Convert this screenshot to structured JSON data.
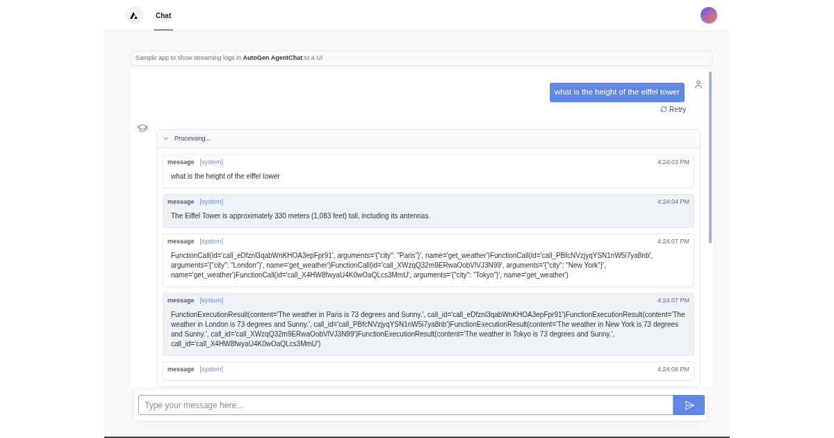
{
  "header": {
    "tabs": [
      {
        "label": "Chat",
        "selected": true
      }
    ]
  },
  "banner": {
    "text": "Sample app to show streaming logs in **AutoGen AgentChat** to a UI"
  },
  "chat": {
    "user_message": "what is the height of the eiffel tower",
    "retry_label": "Retry",
    "processing": {
      "title": "Processing...",
      "expanded": true,
      "messages": [
        {
          "label": "message",
          "source": "[system]",
          "time": "4:24:03 PM",
          "text": "what is the height of the eiffel tower"
        },
        {
          "label": "message",
          "source": "[system]",
          "time": "4:24:04 PM",
          "text": "The Eiffel Tower is approximately 330 meters (1,083 feet) tall, including its antennas."
        },
        {
          "label": "message",
          "source": "[system]",
          "time": "4:24:07 PM",
          "text": "FunctionCall(id='call_eDfznl3qabWnKHOA3epFpr91', arguments='{\"city\": \"Paris\"}', name='get_weather')FunctionCall(id='call_PBfcNVzjyqYSN1nW5i7ya8nb', arguments='{\"city\": \"London\"}', name='get_weather')FunctionCall(id='call_XWzqQ32m9ERwaOobVlVJ3N99', arguments='{\"city\": \"New York\"}', name='get_weather')FunctionCall(id='call_X4HW8fwyaU4K0wOaQLcs3MmU', arguments='{\"city\": \"Tokyo\"}', name='get_weather')"
        },
        {
          "label": "message",
          "source": "[system]",
          "time": "4:24:07 PM",
          "text": "FunctionExecutionResult(content='The weather in Paris is 73 degrees and Sunny.', call_id='call_eDfznl3qabWnKHOA3epFpr91')FunctionExecutionResult(content='The weather in London is 73 degrees and Sunny.', call_id='call_PBfcNVzjyqYSN1nW5i7ya8nb')FunctionExecutionResult(content='The weather in New York is 73 degrees and Sunny.', call_id='call_XWzqQ32m9ERwaOobVlVJ3N99')FunctionExecutionResult(content='The weather in Tokyo is 73 degrees and Sunny.', call_id='call_X4HW8fwyaU4K0wOaQLcs3MmU')"
        },
        {
          "label": "message",
          "source": "[system]",
          "time": "4:24:08 PM"
        }
      ]
    }
  },
  "composer": {
    "placeholder": "Type your message here..."
  }
}
